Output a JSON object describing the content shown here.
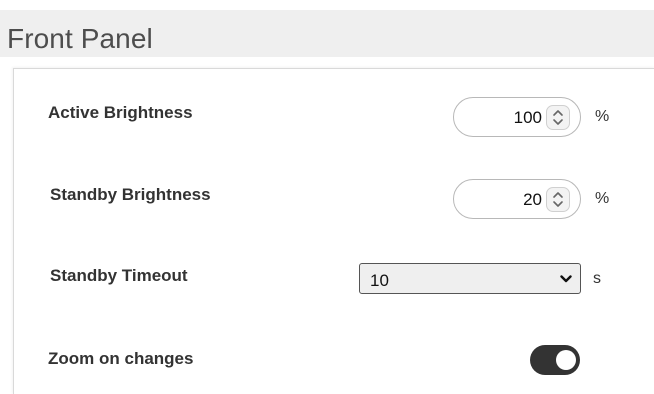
{
  "panel": {
    "title": "Front Panel"
  },
  "settings": {
    "active_brightness": {
      "label": "Active Brightness",
      "value": "100",
      "unit": "%"
    },
    "standby_brightness": {
      "label": "Standby Brightness",
      "value": "20",
      "unit": "%"
    },
    "standby_timeout": {
      "label": "Standby Timeout",
      "selected": "10",
      "unit": "s"
    },
    "zoom_on_changes": {
      "label": "Zoom on changes",
      "enabled": true
    }
  },
  "icons": {
    "spinner": "updown-arrows-icon",
    "dropdown": "chevron-down-icon",
    "toggle": "toggle-switch"
  },
  "colors": {
    "header_bg": "#efefef",
    "toggle_on": "#333333",
    "text": "#333333"
  }
}
